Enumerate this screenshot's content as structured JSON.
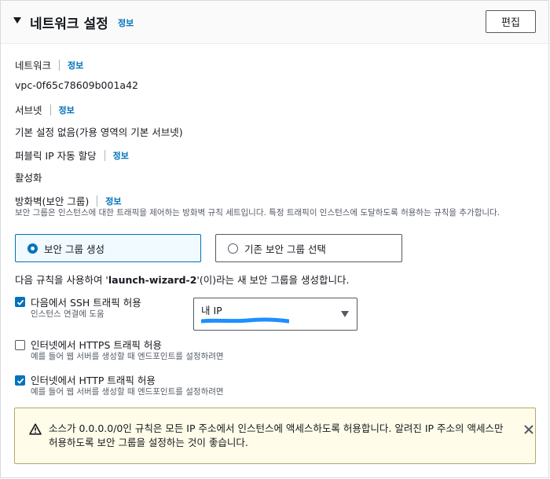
{
  "header": {
    "title": "네트워크 설정",
    "info": "정보",
    "edit_label": "편집"
  },
  "fields": {
    "network": {
      "label": "네트워크",
      "info": "정보",
      "value": "vpc-0f65c78609b001a42"
    },
    "subnet": {
      "label": "서브넷",
      "info": "정보",
      "value": "기본 설정 없음(가용 영역의 기본 서브넷)"
    },
    "public_ip": {
      "label": "퍼블릭 IP 자동 할당",
      "info": "정보",
      "value": "활성화"
    },
    "firewall": {
      "label": "방화벽(보안 그룹)",
      "info": "정보",
      "description": "보안 그룹은 인스턴스에 대한 트래픽을 제어하는 방화벽 규칙 세트입니다. 특정 트래픽이 인스턴스에 도달하도록 허용하는 규칙을 추가합니다."
    }
  },
  "security_group_options": {
    "create": {
      "label": "보안 그룹 생성",
      "selected": true
    },
    "existing": {
      "label": "기존 보안 그룹 선택",
      "selected": false
    }
  },
  "rule_intro": {
    "prefix": "다음 규칙을 사용하여 '",
    "group_name": "launch-wizard-2",
    "suffix": "'(이)라는 새 보안 그룹을 생성합니다."
  },
  "rules": {
    "ssh": {
      "label": "다음에서 SSH 트래픽 허용",
      "description": "인스턴스 연결에 도움",
      "checked": true
    },
    "https": {
      "label": "인터넷에서 HTTPS 트래픽 허용",
      "description": "예를 들어 웹 서버를 생성할 때 엔드포인트를 설정하려면",
      "checked": false
    },
    "http": {
      "label": "인터넷에서 HTTP 트래픽 허용",
      "description": "예를 들어 웹 서버를 생성할 때 엔드포인트를 설정하려면",
      "checked": true
    }
  },
  "ssh_source_select": {
    "selected": "내 IP"
  },
  "warning": {
    "text": "소스가 0.0.0.0/0인 규칙은 모든 IP 주소에서 인스턴스에 액세스하도록 허용합니다. 알려진 IP 주소의 액세스만 허용하도록 보안 그룹을 설정하는 것이 좋습니다."
  },
  "icons": {
    "collapse": "caret-down-icon",
    "checkbox": "check-icon",
    "dropdown": "triangle-down-icon",
    "warning": "warning-triangle-icon",
    "close": "close-icon"
  },
  "colors": {
    "accent": "#0073bb",
    "warning_bg": "#fffce9",
    "warning_border": "#b8a56a",
    "redaction": "#1f8fff"
  }
}
